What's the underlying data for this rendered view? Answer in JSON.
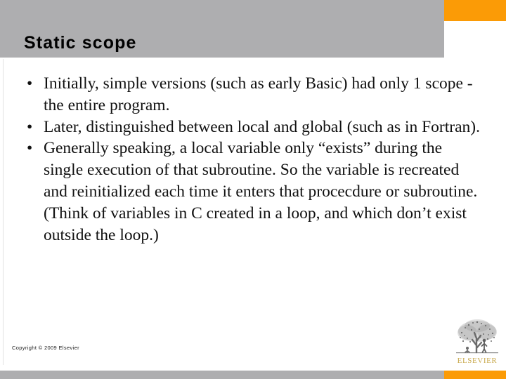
{
  "slide": {
    "title": "Static scope",
    "bullets": [
      "Initially, simple versions (such as early Basic) had only 1 scope - the entire program.",
      "Later, distinguished between local and global (such as in Fortran).",
      "Generally speaking, a local variable only “exists” during the single execution of that subroutine.  So the variable is recreated and reinitialized each time it enters that procecdure or subroutine.  (Think of variables in C created in a loop, and which don’t exist outside the loop.)"
    ],
    "bullet_marker": "•",
    "copyright": "Copyright © 2009 Elsevier",
    "logo": {
      "wordmark": "ELSEVIER",
      "icon": "elsevier-tree-logo"
    },
    "colors": {
      "header_gray": "#aeaeb0",
      "accent_orange": "#fb9b06",
      "logo_gold": "#c8a84b",
      "text_black": "#111111",
      "background": "#ffffff"
    }
  }
}
